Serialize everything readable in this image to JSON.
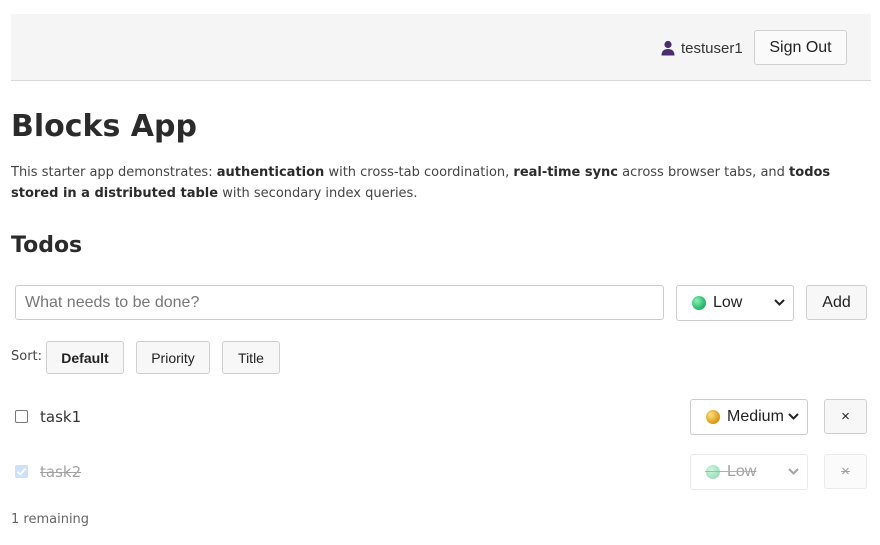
{
  "header": {
    "username": "testuser1",
    "sign_out_label": "Sign Out",
    "user_icon": "person-icon"
  },
  "page": {
    "title": "Blocks App",
    "description": {
      "part1": "This starter app demonstrates: ",
      "bold1": "authentication",
      "part2": " with cross-tab coordination, ",
      "bold2": "real-time sync",
      "part3": " across browser tabs, and ",
      "bold3": "todos stored in a distributed table",
      "part4": " with secondary index queries."
    },
    "section_title": "Todos"
  },
  "new_todo": {
    "placeholder": "What needs to be done?",
    "value": "",
    "priority": "Low",
    "add_label": "Add"
  },
  "sort": {
    "label": "Sort:",
    "options": [
      "Default",
      "Priority",
      "Title"
    ],
    "active": "Default"
  },
  "todos": [
    {
      "title": "task1",
      "done": false,
      "priority": "Medium",
      "delete_label": "×"
    },
    {
      "title": "task2",
      "done": true,
      "priority": "Low",
      "delete_label": "×"
    }
  ],
  "footer": {
    "remaining": "1 remaining"
  },
  "colors": {
    "low": "#2fbf71",
    "medium": "#e2a421",
    "header_bg": "#f5f5f5",
    "checkbox_checked": "#8ab9ef",
    "user_icon": "#4b2c6e"
  }
}
